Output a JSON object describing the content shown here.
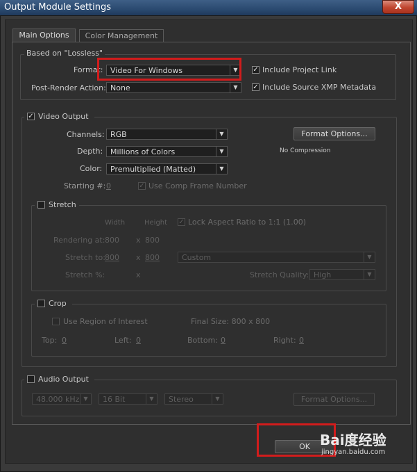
{
  "window": {
    "title": "Output Module Settings",
    "close_glyph": "X"
  },
  "tabs": [
    {
      "label": "Main Options",
      "active": true
    },
    {
      "label": "Color Management",
      "active": false
    }
  ],
  "based_on": {
    "title": "Based on \"Lossless\"",
    "format_label": "Format:",
    "format_value": "Video For Windows",
    "post_render_label": "Post-Render Action:",
    "post_render_value": "None",
    "include_project_link": {
      "label": "Include Project Link",
      "checked": true
    },
    "include_xmp": {
      "label": "Include Source XMP Metadata",
      "checked": true
    }
  },
  "video_output": {
    "title": "Video Output",
    "checked": true,
    "channels_label": "Channels:",
    "channels_value": "RGB",
    "depth_label": "Depth:",
    "depth_value": "Millions of Colors",
    "color_label": "Color:",
    "color_value": "Premultiplied (Matted)",
    "starting_label": "Starting #:",
    "starting_value": "0",
    "use_comp_frame": {
      "label": "Use Comp Frame Number",
      "checked": true
    },
    "format_options_label": "Format Options...",
    "compression_text": "No Compression"
  },
  "stretch": {
    "title": "Stretch",
    "checked": false,
    "width_header": "Width",
    "height_header": "Height",
    "lock_aspect": {
      "label": "Lock Aspect Ratio to 1:1 (1.00)",
      "checked": true
    },
    "rendering_at_label": "Rendering at:",
    "rendering_w": "800",
    "rendering_x": "x",
    "rendering_h": "800",
    "stretch_to_label": "Stretch to:",
    "stretch_w": "800",
    "stretch_x": "x",
    "stretch_h": "800",
    "preset_value": "Custom",
    "stretch_pct_label": "Stretch %:",
    "stretch_pct_x": "x",
    "quality_label": "Stretch Quality:",
    "quality_value": "High"
  },
  "crop": {
    "title": "Crop",
    "checked": false,
    "use_roi": {
      "label": "Use Region of Interest",
      "checked": false
    },
    "final_size": "Final Size: 800 x 800",
    "top_label": "Top:",
    "top_value": "0",
    "left_label": "Left:",
    "left_value": "0",
    "bottom_label": "Bottom:",
    "bottom_value": "0",
    "right_label": "Right:",
    "right_value": "0"
  },
  "audio_output": {
    "title": "Audio Output",
    "checked": false,
    "rate_value": "48.000 kHz",
    "bits_value": "16 Bit",
    "channels_value": "Stereo",
    "format_options_label": "Format Options..."
  },
  "footer": {
    "ok_label": "OK"
  },
  "watermark": {
    "brand": "Bai度经验",
    "url": "jingyan.baidu.com"
  },
  "colors": {
    "highlight_box": "#d21c1c",
    "titlebar": "#2b4a70",
    "close_button": "#c0452f"
  }
}
